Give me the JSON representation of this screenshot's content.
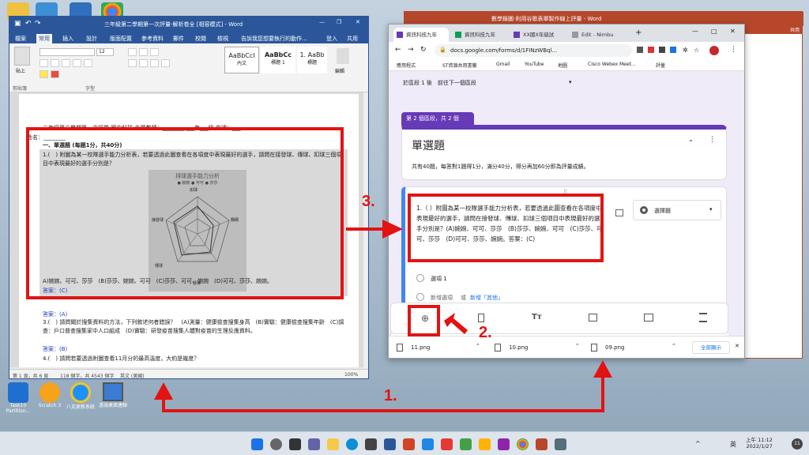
{
  "desktop": {
    "icons": [
      {
        "label": "Task10\nPartition..."
      },
      {
        "label": "Scratch 3"
      },
      {
        "label": "八克更新系統"
      },
      {
        "label": "遠端桌面連線"
      }
    ]
  },
  "word": {
    "title": "三年級第二學期第一次評量-解析卷全 [相容模式] - Word",
    "tabs": [
      "檔案",
      "常用",
      "插入",
      "設計",
      "版面配置",
      "參考資料",
      "郵件",
      "校閱",
      "檢視"
    ],
    "tell_me": "告訴我您想要執行的動作...",
    "login": "登入",
    "share": "共用",
    "ribbon": {
      "clipboard": "剪貼簿",
      "font": "字型",
      "font_size": "12",
      "styles": [
        "AaBbCcI",
        "AaBbCc",
        "1. AaBb"
      ],
      "style_names": [
        "內文",
        "標題 1",
        "標題"
      ],
      "paste": "貼上",
      "find": "尋找",
      "edit": "編輯"
    },
    "doc": {
      "header": "三年級第二學期第一次評量  國中科技  命題教師：________  ___年___級  座號：___",
      "name_line": "姓名：________",
      "section": "一、單選題 (每題1分，共40分)",
      "q1": "1.(　) 附圖為某一校隊選手能力分析表，若要透過此圖查看在各項度中表現最好的選手，請問在接發球、傳球、扣球三個項目中表現最好的選手分別是？",
      "chart_title": "排球選手能力分析",
      "chart_legend": [
        "婉婉",
        "可可",
        "莎莎"
      ],
      "chart_labels": [
        "扣球",
        "欄網",
        "接發球",
        "傳球",
        "發球"
      ],
      "q1_options": "A)婉婉、可可、莎莎　(B)莎莎、婉婉、可可　(C)莎莎、可可、婉婉　(D)可可、莎莎、婉婉。",
      "q1_answer": "答案：(C)",
      "q2_answer": "答案：(A)",
      "q3": "3.(　) 請問關於搜集資料的方法，下列敘述何者錯誤？　(A)測量：健康檢查搜集身高　(B)實驗：健康檢查搜集年齡　(C)調查：戶口普查搜集家中人口組成　(D)實驗：研發疫苗搜集人體對疫苗的生理反應資料。",
      "q3_answer": "答案：(B)",
      "q4": "4.(　) 請問若要透過附圖查看11月分的最高溫度，大約是幾度？"
    },
    "status": {
      "page": "第 1 頁，共 6 頁",
      "words": "118 個字，共 4543 個字",
      "lang": "英文 (美國)",
      "zoom": "100%"
    }
  },
  "ppt": {
    "title": "數學錄圖-利用谷歌表單製作線上評量 - Word",
    "share": "共用"
  },
  "chrome": {
    "tabs": [
      "資訊科技九年",
      "資訊科技九年",
      "XX國X年級試",
      "Edit - Nimbu"
    ],
    "url": "docs.google.com/forms/d/1FINzWBql...",
    "bookmarks": [
      "應用程式",
      "ST資源共用書籤",
      "Gmail",
      "YouTube",
      "地圖",
      "Cisco Webex Meet...",
      "評量"
    ]
  },
  "form": {
    "section_nav": "於區段 1 後　前往下一個區段",
    "section_badge": "第 2 個區段，共 2 個",
    "section_title": "單選題",
    "section_desc": "共有40題，每答對1題得1分，滿分40分，得分再加60分即為評量成績。",
    "question_text": "1.（ ）附圖為某一校隊選手能力分析表，若要透過此圖查看在各項度中表現最好的選手，請問在接發球、傳球、扣球三個項目中表現最好的選手分別是？(A)婉婉、可可、莎莎　(B)莎莎、婉婉、可可　(C)莎莎、可可、莎莎　(D)可可、莎莎、婉婉。答案：(C)",
    "question_type": "選擇題",
    "option1": "選項 1",
    "add_option": "新增選項",
    "or": "或",
    "add_other": "新增「其他」"
  },
  "downloads": {
    "files": [
      "11.png",
      "10.png",
      "09.png"
    ],
    "show_all": "全部顯示"
  },
  "annotations": {
    "step1": "1.",
    "step2": "2.",
    "step3": "3."
  },
  "taskbar": {
    "time": "上午 11:12",
    "date": "2022/1/27",
    "lang": "英",
    "badge": "11"
  },
  "colors": {
    "red": "#e21313",
    "word_blue": "#2b579a",
    "forms_purple": "#673ab7",
    "ppt_orange": "#b7472a"
  }
}
